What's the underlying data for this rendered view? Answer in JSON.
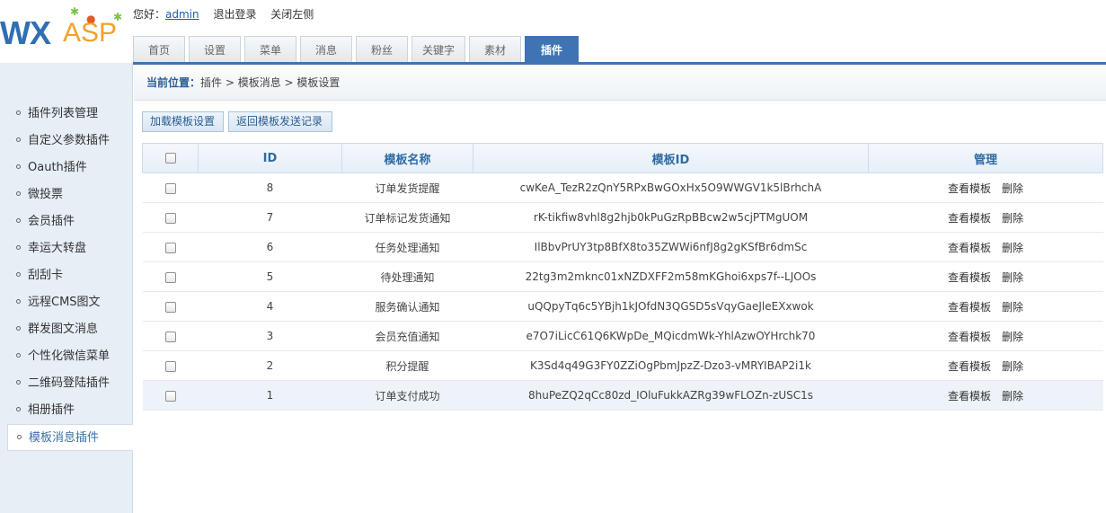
{
  "header": {
    "logo_wx": "WX",
    "logo_asp": "ASP",
    "greeting": "您好：",
    "username": "admin",
    "logout": "退出登录",
    "close_left": "关闭左侧"
  },
  "tabs": [
    "首页",
    "设置",
    "菜单",
    "消息",
    "粉丝",
    "关键字",
    "素材",
    "插件"
  ],
  "active_tab": "插件",
  "sidebar": {
    "items": [
      "插件列表管理",
      "自定义参数插件",
      "Oauth插件",
      "微投票",
      "会员插件",
      "幸运大转盘",
      "刮刮卡",
      "远程CMS图文",
      "群发图文消息",
      "个性化微信菜单",
      "二维码登陆插件",
      "相册插件",
      "模板消息插件"
    ],
    "active": "模板消息插件"
  },
  "breadcrumb": {
    "label": "当前位置：",
    "path": "插件 > 模板消息 > 模板设置"
  },
  "toolbar": {
    "load_label": "加载模板设置",
    "back_label": "返回模板发送记录"
  },
  "table": {
    "columns": [
      "ID",
      "模板名称",
      "模板ID",
      "管理"
    ],
    "view_label": "查看模板",
    "delete_label": "删除",
    "rows": [
      {
        "id": "8",
        "name": "订单发货提醒",
        "template_id": "cwKeA_TezR2zQnY5RPxBwGOxHx5O9WWGV1k5lBrhchA"
      },
      {
        "id": "7",
        "name": "订单标记发货通知",
        "template_id": "rK-tikfiw8vhl8g2hjb0kPuGzRpBBcw2w5cjPTMgUOM"
      },
      {
        "id": "6",
        "name": "任务处理通知",
        "template_id": "IlBbvPrUY3tp8BfX8to35ZWWi6nfJ8g2gKSfBr6dmSc"
      },
      {
        "id": "5",
        "name": "待处理通知",
        "template_id": "22tg3m2mknc01xNZDXFF2m58mKGhoi6xps7f--LJOOs"
      },
      {
        "id": "4",
        "name": "服务确认通知",
        "template_id": "uQQpyTq6c5YBjh1kJOfdN3QGSD5sVqyGaeJleEXxwok"
      },
      {
        "id": "3",
        "name": "会员充值通知",
        "template_id": "e7O7iLicC61Q6KWpDe_MQicdmWk-YhlAzwOYHrchk70"
      },
      {
        "id": "2",
        "name": "积分提醒",
        "template_id": "K3Sd4q49G3FY0ZZiOgPbmJpzZ-Dzo3-vMRYIBAP2i1k"
      },
      {
        "id": "1",
        "name": "订单支付成功",
        "template_id": "8huPeZQ2qCc80zd_IOluFukkAZRg39wFLOZn-zUSC1s"
      }
    ]
  },
  "colors": {
    "accent": "#3f74b2",
    "sidebar_bg": "#e6eef6",
    "header_text": "#2e6ba3"
  }
}
